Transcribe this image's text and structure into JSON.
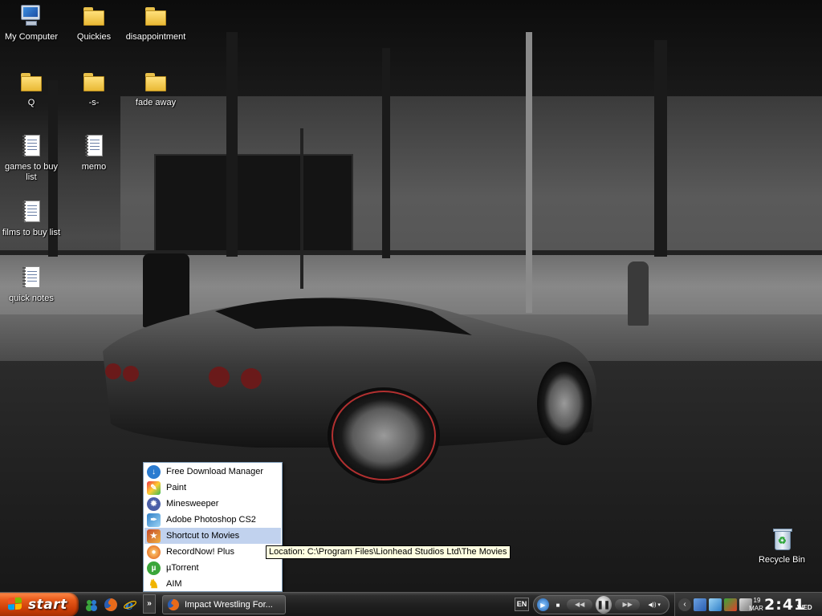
{
  "desktop": {
    "icons": [
      {
        "label": "My Computer",
        "kind": "computer-icon"
      },
      {
        "label": "Quickies",
        "kind": "folder-icon"
      },
      {
        "label": "disappointment",
        "kind": "folder-icon"
      },
      {
        "label": "Q",
        "kind": "folder-icon"
      },
      {
        "label": "-s-",
        "kind": "folder-icon"
      },
      {
        "label": "fade away",
        "kind": "folder-icon"
      },
      {
        "label": "games to buy list",
        "kind": "notepad-icon"
      },
      {
        "label": "memo",
        "kind": "notepad-icon"
      },
      {
        "label": "films to buy list",
        "kind": "notepad-icon"
      },
      {
        "label": "quick notes",
        "kind": "notepad-icon"
      },
      {
        "label": "Recycle Bin",
        "kind": "recycle-bin-icon"
      }
    ]
  },
  "quicklaunch_menu": {
    "items": [
      {
        "label": "Free Download Manager",
        "icon": "free-download-manager-icon",
        "color": "#2a7bd0"
      },
      {
        "label": "Paint",
        "icon": "paint-icon",
        "color": "#d9a43a"
      },
      {
        "label": "Minesweeper",
        "icon": "minesweeper-icon",
        "color": "#4a5fa8"
      },
      {
        "label": "Adobe Photoshop CS2",
        "icon": "photoshop-icon",
        "color": "#2f7fc8"
      },
      {
        "label": "Shortcut to Movies",
        "icon": "movies-icon",
        "color": "#c44a2a"
      },
      {
        "label": "RecordNow! Plus",
        "icon": "recordnow-icon",
        "color": "#e05a10"
      },
      {
        "label": "µTorrent",
        "icon": "utorrent-icon",
        "color": "#3aa63a"
      },
      {
        "label": "AIM",
        "icon": "aim-icon",
        "color": "#f0b400"
      }
    ],
    "hovered_index": 4
  },
  "tooltip": {
    "text": "Location: C:\\Program Files\\Lionhead Studios Ltd\\The Movies"
  },
  "taskbar": {
    "start_label": "start",
    "quicklaunch": [
      {
        "icon": "msn-messenger-icon",
        "color": "#3aa63a"
      },
      {
        "icon": "firefox-icon",
        "color": "#e86a1a"
      },
      {
        "icon": "internet-explorer-icon",
        "color": "#2a7bd0"
      }
    ],
    "overflow_label": "»",
    "task_button": {
      "label": "Impact Wrestling For...",
      "icon": "firefox-icon"
    },
    "language": "EN",
    "media_player": {
      "buttons": [
        "stop",
        "previous",
        "play-pause",
        "next",
        "volume"
      ],
      "play_symbol": "❚❚",
      "stop_symbol": "■",
      "prev_symbol": "◀◀",
      "next_symbol": "▶▶",
      "volume_symbol": "◀)) ▾"
    },
    "tray_icons": [
      "show-hidden-icons-chevron",
      "network-icon",
      "display-icon",
      "security-icon",
      "volume-icon",
      "device-icon"
    ],
    "clock": {
      "day": "19",
      "month": "MAR",
      "time": "2:41",
      "weekday": "WED"
    }
  },
  "colors": {
    "start_button": "#e85a1a",
    "taskbar": "#202020",
    "menu_highlight": "#c1d2ee",
    "tooltip_bg": "#ffffe1"
  }
}
